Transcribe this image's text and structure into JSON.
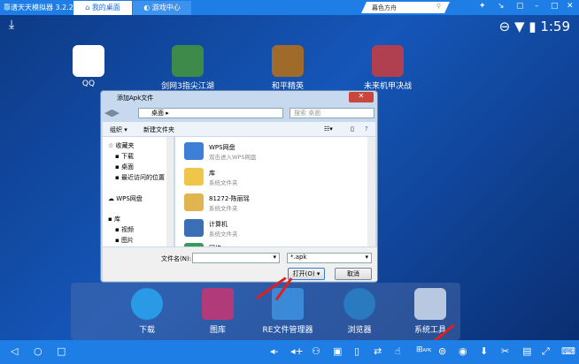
{
  "window": {
    "title": "靠谱天天模拟器 3.2.2",
    "tabs": [
      {
        "label": "我的桌面",
        "icon": "home-icon"
      },
      {
        "label": "游戏中心",
        "icon": "gamepad-icon"
      }
    ],
    "search_value": "暮色方舟",
    "controls": [
      "pin",
      "minimize-to-tray",
      "restore",
      "minimize",
      "maximize",
      "close"
    ]
  },
  "status": {
    "time": "1:59"
  },
  "desktop_apps": [
    {
      "label": "QQ",
      "color": "#ffffff"
    },
    {
      "label": "剑网3指尖江湖",
      "color": "#3d8a4a"
    },
    {
      "label": "和平精英",
      "color": "#a06a2a"
    },
    {
      "label": "未来机甲决战",
      "color": "#b04050"
    }
  ],
  "dialog": {
    "title": "添加Apk文件",
    "close": "✕",
    "address": "桌面",
    "search_placeholder": "搜索 桌面",
    "toolbar": {
      "organize": "组织 ▾",
      "new_folder": "新建文件夹"
    },
    "nav": [
      {
        "label": "收藏夹",
        "icon": "star-icon"
      },
      {
        "label": "下载",
        "icon": "download-folder-icon"
      },
      {
        "label": "桌面",
        "icon": "desktop-icon"
      },
      {
        "label": "最近访问的位置",
        "icon": "recent-icon"
      },
      {
        "label": "WPS网盘",
        "icon": "cloud-icon"
      },
      {
        "label": "库",
        "icon": "library-icon"
      },
      {
        "label": "视频",
        "icon": "video-icon"
      },
      {
        "label": "图片",
        "icon": "picture-icon"
      }
    ],
    "files": [
      {
        "name": "WPS网盘",
        "sub": "双击进入WPS网盘",
        "color": "#3d7fd6"
      },
      {
        "name": "库",
        "sub": "系统文件夹",
        "color": "#f0c64a"
      },
      {
        "name": "81272-陈丽瑶",
        "sub": "系统文件夹",
        "color": "#e0b550"
      },
      {
        "name": "计算机",
        "sub": "系统文件夹",
        "color": "#3a6fb5"
      },
      {
        "name": "网络",
        "sub": "",
        "color": "#3a9a5a"
      }
    ],
    "filename_label": "文件名(N):",
    "filename_value": "",
    "filter": "*.apk",
    "open": "打开(O)",
    "cancel": "取消"
  },
  "dock": [
    {
      "label": "下载",
      "color": "#2a9ae6"
    },
    {
      "label": "图库",
      "color": "#b03a7a"
    },
    {
      "label": "RE文件管理器",
      "color": "#3a8ad8"
    },
    {
      "label": "浏览器",
      "color": "#2a7ac0"
    },
    {
      "label": "系统工具",
      "color": "#b8c8e0"
    }
  ],
  "navbar_icons": [
    "volume-down",
    "volume-up",
    "shake",
    "toolbox",
    "phone-rotate",
    "keymap",
    "touch",
    "apk-install",
    "location",
    "camera",
    "install",
    "screenshot",
    "folder",
    "fullscreen",
    "keyboard"
  ],
  "navbar_apk_label": "APK"
}
